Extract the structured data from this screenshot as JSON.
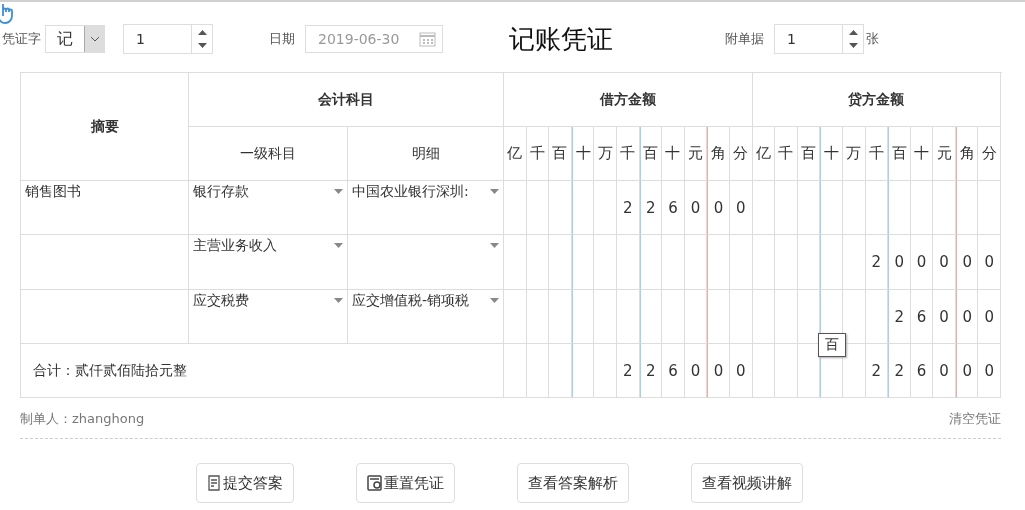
{
  "header": {
    "voucher_word_label": "凭证字",
    "voucher_word": "记",
    "number": "1",
    "date_label": "日期",
    "date": "2019-06-30",
    "title": "记账凭证",
    "attachments_label": "附单据",
    "attachments": "1",
    "attachments_unit": "张"
  },
  "table": {
    "summary_heading": "摘要",
    "account_heading": "会计科目",
    "debit_heading": "借方金额",
    "credit_heading": "贷方金额",
    "level1_heading": "一级科目",
    "detail_heading": "明细",
    "debit_digit_headings": [
      "亿",
      "千",
      "百",
      "十",
      "万",
      "千",
      "百",
      "十",
      "元",
      "角",
      "分"
    ],
    "credit_digit_headings": [
      "亿",
      "千",
      "百",
      "十",
      "万",
      "千",
      "百",
      "十",
      "元",
      "角",
      "分"
    ],
    "rows": [
      {
        "summary": "销售图书",
        "account": "银行存款",
        "detail": "中国农业银行深圳:",
        "debit": [
          "2",
          "2",
          "6",
          "0",
          "0",
          "0"
        ]
      },
      {
        "account": "主营业务收入",
        "credit": [
          "2",
          "0",
          "0",
          "0",
          "0",
          "0"
        ]
      },
      {
        "account": "应交税费",
        "detail": "应交增值税-销项税",
        "credit": [
          "2",
          "6",
          "0",
          "0",
          "0"
        ]
      }
    ],
    "total_label": "合计：贰仟贰佰陆拾元整",
    "total_debit": [
      "2",
      "2",
      "6",
      "0",
      "0",
      "0"
    ],
    "total_credit": [
      "2",
      "2",
      "6",
      "0",
      "0",
      "0"
    ]
  },
  "tooltip": "百",
  "footer": {
    "maker": "制单人：zhanghong",
    "clear_link": "清空凭证"
  },
  "buttons": [
    {
      "label": "提交答案",
      "kind": "submit"
    },
    {
      "label": "重置凭证",
      "kind": "reset"
    },
    {
      "label": "查看答案解析",
      "kind": "plain"
    },
    {
      "label": "查看视频讲解",
      "kind": "plain"
    }
  ]
}
